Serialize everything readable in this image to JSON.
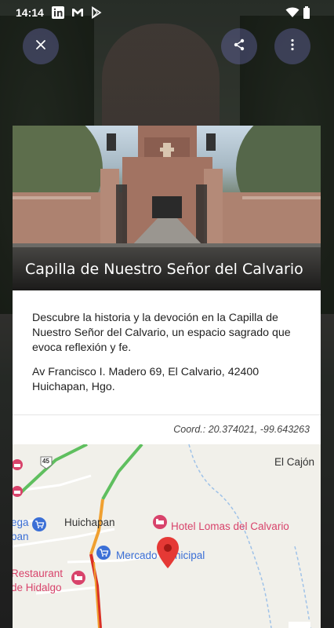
{
  "status_bar": {
    "time": "14:14",
    "left_icons": [
      "linkedin-icon",
      "gmail-icon",
      "play-store-icon"
    ],
    "right_icons": [
      "wifi-icon",
      "battery-icon"
    ]
  },
  "top_actions": {
    "close_icon": "close-icon",
    "share_icon": "share-icon",
    "more_icon": "more-vert-icon"
  },
  "place": {
    "title": "Capilla de Nuestro Señor del Calvario",
    "description": "Descubre la historia y la devoción en la Capilla de Nuestro Señor del Calvario, un espacio sagrado que evoca reflexión y fe.",
    "address": "Av Francisco I. Madero 69, El Calvario, 42400 Huichapan, Hgo.",
    "coordinates": "Coord.: 20.374021, -99.643263"
  },
  "map": {
    "labels": {
      "el_cajon": "El Cajón",
      "huichapan": "Huichapan",
      "hotel": "Hotel Lomas del Calvario",
      "mercado": "Mercado Municipal",
      "restaurant_1": "Restaurant",
      "restaurant_2": "de Hidalgo",
      "bodega_1": "ega",
      "bodega_2": "ban",
      "route_number": "45"
    },
    "colors": {
      "hotel": "#d8436b",
      "mercado": "#3b6fd6",
      "pin": "#e53935",
      "road_green": "#5fbf5f",
      "road_orange": "#f0a030",
      "road_red": "#d93025"
    }
  }
}
